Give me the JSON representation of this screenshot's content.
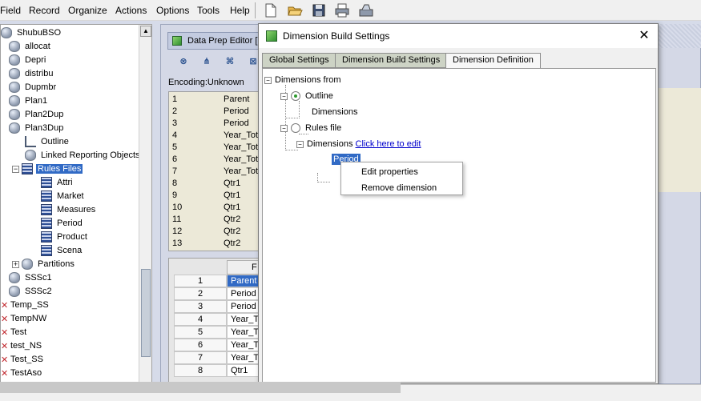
{
  "menubar": {
    "items": [
      "Field",
      "Record",
      "Organize",
      "Actions",
      "Options",
      "Tools",
      "Help"
    ],
    "toolbar_icons": [
      "new-document-icon",
      "open-folder-icon",
      "save-icon",
      "print-icon",
      "scanner-icon"
    ]
  },
  "tree": {
    "rows": [
      {
        "label": "ShubuBSO",
        "icon": "database-icon"
      },
      {
        "label": "allocat",
        "icon": "database-icon"
      },
      {
        "label": "Depri",
        "icon": "database-icon"
      },
      {
        "label": "distribu",
        "icon": "database-icon"
      },
      {
        "label": "Dupmbr",
        "icon": "database-icon"
      },
      {
        "label": "Plan1",
        "icon": "database-icon"
      },
      {
        "label": "Plan2Dup",
        "icon": "database-icon"
      },
      {
        "label": "Plan3Dup",
        "icon": "database-icon"
      },
      {
        "label": "Outline",
        "icon": "outline-icon"
      },
      {
        "label": "Linked Reporting Objects",
        "icon": "lro-icon"
      },
      {
        "label": "Rules Files",
        "icon": "rules-file-icon"
      },
      {
        "label": "Attri",
        "icon": "rules-file-icon"
      },
      {
        "label": "Market",
        "icon": "rules-file-icon"
      },
      {
        "label": "Measures",
        "icon": "rules-file-icon"
      },
      {
        "label": "Period",
        "icon": "rules-file-icon"
      },
      {
        "label": "Product",
        "icon": "rules-file-icon"
      },
      {
        "label": "Scena",
        "icon": "rules-file-icon"
      },
      {
        "label": "Partitions",
        "icon": "partitions-icon"
      },
      {
        "label": "SSSc1",
        "icon": "database-icon"
      },
      {
        "label": "SSSc2",
        "icon": "database-icon"
      },
      {
        "label": "Temp_SS",
        "icon": "app-stopped-icon"
      },
      {
        "label": "TempNW",
        "icon": "app-stopped-icon"
      },
      {
        "label": "Test",
        "icon": "app-stopped-icon"
      },
      {
        "label": "test_NS",
        "icon": "app-stopped-icon"
      },
      {
        "label": "Test_SS",
        "icon": "app-stopped-icon"
      },
      {
        "label": "TestAso",
        "icon": "app-stopped-icon"
      }
    ]
  },
  "editor": {
    "title": "Data Prep Editor [L",
    "encoding": "Encoding:Unknown",
    "grid1": [
      {
        "n": "1",
        "v": "Parent"
      },
      {
        "n": "2",
        "v": "Period"
      },
      {
        "n": "3",
        "v": "Period"
      },
      {
        "n": "4",
        "v": "Year_Tot"
      },
      {
        "n": "5",
        "v": "Year_Tot"
      },
      {
        "n": "6",
        "v": "Year_Tot"
      },
      {
        "n": "7",
        "v": "Year_Tot"
      },
      {
        "n": "8",
        "v": "Qtr1"
      },
      {
        "n": "9",
        "v": "Qtr1"
      },
      {
        "n": "10",
        "v": "Qtr1"
      },
      {
        "n": "11",
        "v": "Qtr2"
      },
      {
        "n": "12",
        "v": "Qtr2"
      },
      {
        "n": "13",
        "v": "Qtr2"
      }
    ],
    "grid2_header": "F",
    "grid2": [
      {
        "n": "1",
        "v": "Parent"
      },
      {
        "n": "2",
        "v": "Period"
      },
      {
        "n": "3",
        "v": "Period"
      },
      {
        "n": "4",
        "v": "Year_To"
      },
      {
        "n": "5",
        "v": "Year_To"
      },
      {
        "n": "6",
        "v": "Year_To"
      },
      {
        "n": "7",
        "v": "Year_To"
      },
      {
        "n": "8",
        "v": "Qtr1"
      }
    ]
  },
  "dialog": {
    "title": "Dimension Build Settings",
    "tabs": [
      "Global Settings",
      "Dimension Build Settings",
      "Dimension Definition"
    ],
    "dimensions_from": "Dimensions from",
    "outline": "Outline",
    "dimensions_under_outline": "Dimensions",
    "rules_file": "Rules file",
    "dimensions_under_rules": "Dimensions",
    "edit_link": "Click here to edit",
    "selected_dimension": "Period"
  },
  "context_menu": {
    "items": [
      "Edit properties",
      "Remove dimension"
    ]
  }
}
